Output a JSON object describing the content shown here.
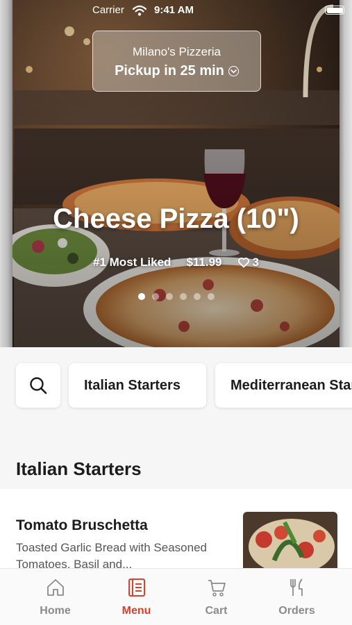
{
  "status_bar": {
    "carrier": "Carrier",
    "time": "9:41 AM"
  },
  "pickup": {
    "restaurant_name": "Milano's Pizzeria",
    "pickup_text": "Pickup in 25 min"
  },
  "featured": {
    "title": "Cheese Pizza (10\")",
    "badge": "#1 Most Liked",
    "price": "$11.99",
    "likes": "3",
    "carousel_count": 6,
    "carousel_active": 0
  },
  "categories": [
    "Italian Starters",
    "Mediterranean Starters"
  ],
  "section_title": "Italian Starters",
  "menu_items": [
    {
      "name": "Tomato Bruschetta",
      "description": "Toasted Garlic Bread with Seasoned Tomatoes, Basil and..."
    }
  ],
  "tabs": [
    {
      "label": "Home",
      "icon": "home-icon",
      "active": false
    },
    {
      "label": "Menu",
      "icon": "menu-book-icon",
      "active": true
    },
    {
      "label": "Cart",
      "icon": "cart-icon",
      "active": false
    },
    {
      "label": "Orders",
      "icon": "fork-knife-icon",
      "active": false
    }
  ],
  "colors": {
    "accent": "#d8412c",
    "inactive_tab": "#8a8a8a",
    "background": "#f6f6f6"
  }
}
